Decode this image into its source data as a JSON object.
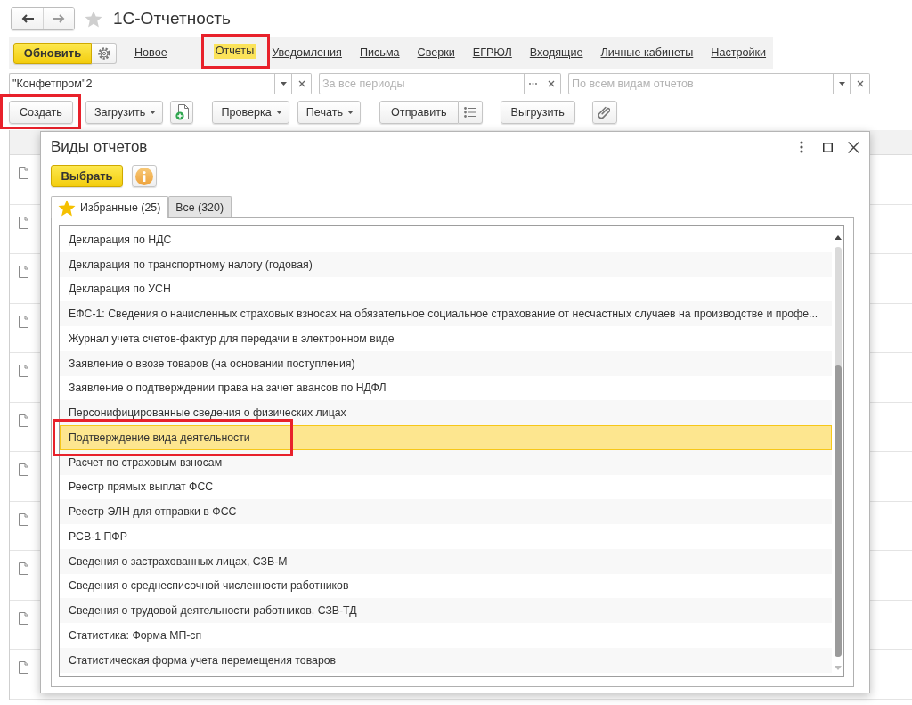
{
  "header": {
    "navigation": [
      {
        "kind": "back",
        "disabled": false
      },
      {
        "kind": "forward",
        "disabled": true
      }
    ],
    "favorite": false,
    "title": "1С-Отчетность"
  },
  "command_bar": {
    "refresh_button": "Обновить",
    "links": [
      {
        "label": "Новое",
        "selected": false,
        "callout": false
      },
      {
        "label": "Отчеты",
        "selected": true,
        "callout": true
      },
      {
        "label": "Уведомления",
        "selected": false,
        "callout": false
      },
      {
        "label": "Письма",
        "selected": false,
        "callout": false
      },
      {
        "label": "Сверки",
        "selected": false,
        "callout": false
      },
      {
        "label": "ЕГРЮЛ",
        "selected": false,
        "callout": false
      },
      {
        "label": "Входящие",
        "selected": false,
        "callout": false
      },
      {
        "label": "Личные кабинеты",
        "selected": false,
        "callout": false
      },
      {
        "label": "Настройки",
        "selected": false,
        "callout": false
      }
    ]
  },
  "filters": [
    {
      "kind": "select",
      "value": "\"Конфетпром\"2"
    },
    {
      "kind": "period",
      "placeholder": "За все периоды"
    },
    {
      "kind": "select",
      "placeholder": "По всем видам отчетов"
    }
  ],
  "toolbar": [
    {
      "kind": "button",
      "label": "Создать",
      "callout": true
    },
    {
      "kind": "menu",
      "label": "Загрузить",
      "callout": false
    },
    {
      "kind": "add",
      "callout": false
    },
    {
      "kind": "menu",
      "label": "Проверка",
      "callout": false
    },
    {
      "kind": "menu",
      "label": "Печать",
      "callout": false
    },
    {
      "kind": "split",
      "label": "Отправить",
      "callout": false
    },
    {
      "kind": "button",
      "label": "Выгрузить",
      "callout": false
    },
    {
      "kind": "attach",
      "callout": false
    }
  ],
  "documents": [
    {
      "kind": "document"
    },
    {
      "kind": "document"
    },
    {
      "kind": "document"
    },
    {
      "kind": "document"
    },
    {
      "kind": "document"
    },
    {
      "kind": "document"
    },
    {
      "kind": "document"
    },
    {
      "kind": "document"
    },
    {
      "kind": "document"
    },
    {
      "kind": "document"
    },
    {
      "kind": "document"
    }
  ],
  "dialog": {
    "title": "Виды отчетов",
    "choose_button": "Выбрать",
    "tabs": [
      {
        "kind": "favorites",
        "label": "Избранные (25)",
        "selected": true
      },
      {
        "kind": "all",
        "label": "Все (320)",
        "selected": false
      }
    ],
    "items": [
      {
        "label": "Декларация по НДС",
        "selected": false,
        "callout": false
      },
      {
        "label": "Декларация по транспортному налогу (годовая)",
        "selected": false,
        "callout": false
      },
      {
        "label": "Декларация по УСН",
        "selected": false,
        "callout": false
      },
      {
        "label": "ЕФС-1: Сведения о начисленных страховых взносах на обязательное социальное страхование от несчастных случаев на производстве и профе...",
        "selected": false,
        "callout": false
      },
      {
        "label": "Журнал учета счетов-фактур для передачи в электронном виде",
        "selected": false,
        "callout": false
      },
      {
        "label": "Заявление о ввозе товаров (на основании поступления)",
        "selected": false,
        "callout": false
      },
      {
        "label": "Заявление о подтверждении права на зачет авансов по НДФЛ",
        "selected": false,
        "callout": false
      },
      {
        "label": "Персонифицированные сведения о физических лицах",
        "selected": false,
        "callout": false
      },
      {
        "label": "Подтверждение вида деятельности",
        "selected": true,
        "callout": true
      },
      {
        "label": "Расчет по страховым взносам",
        "selected": false,
        "callout": false
      },
      {
        "label": "Реестр прямых выплат ФСС",
        "selected": false,
        "callout": false
      },
      {
        "label": "Реестр ЭЛН для отправки в ФСС",
        "selected": false,
        "callout": false
      },
      {
        "label": "РСВ-1 ПФР",
        "selected": false,
        "callout": false
      },
      {
        "label": "Сведения о застрахованных лицах, СЗВ-М",
        "selected": false,
        "callout": false
      },
      {
        "label": "Сведения о среднесписочной численности работников",
        "selected": false,
        "callout": false
      },
      {
        "label": "Сведения о трудовой деятельности работников, СЗВ-ТД",
        "selected": false,
        "callout": false
      },
      {
        "label": "Статистика: Форма МП-сп",
        "selected": false,
        "callout": false
      },
      {
        "label": "Статистическая форма учета перемещения товаров",
        "selected": false,
        "callout": false
      }
    ]
  }
}
